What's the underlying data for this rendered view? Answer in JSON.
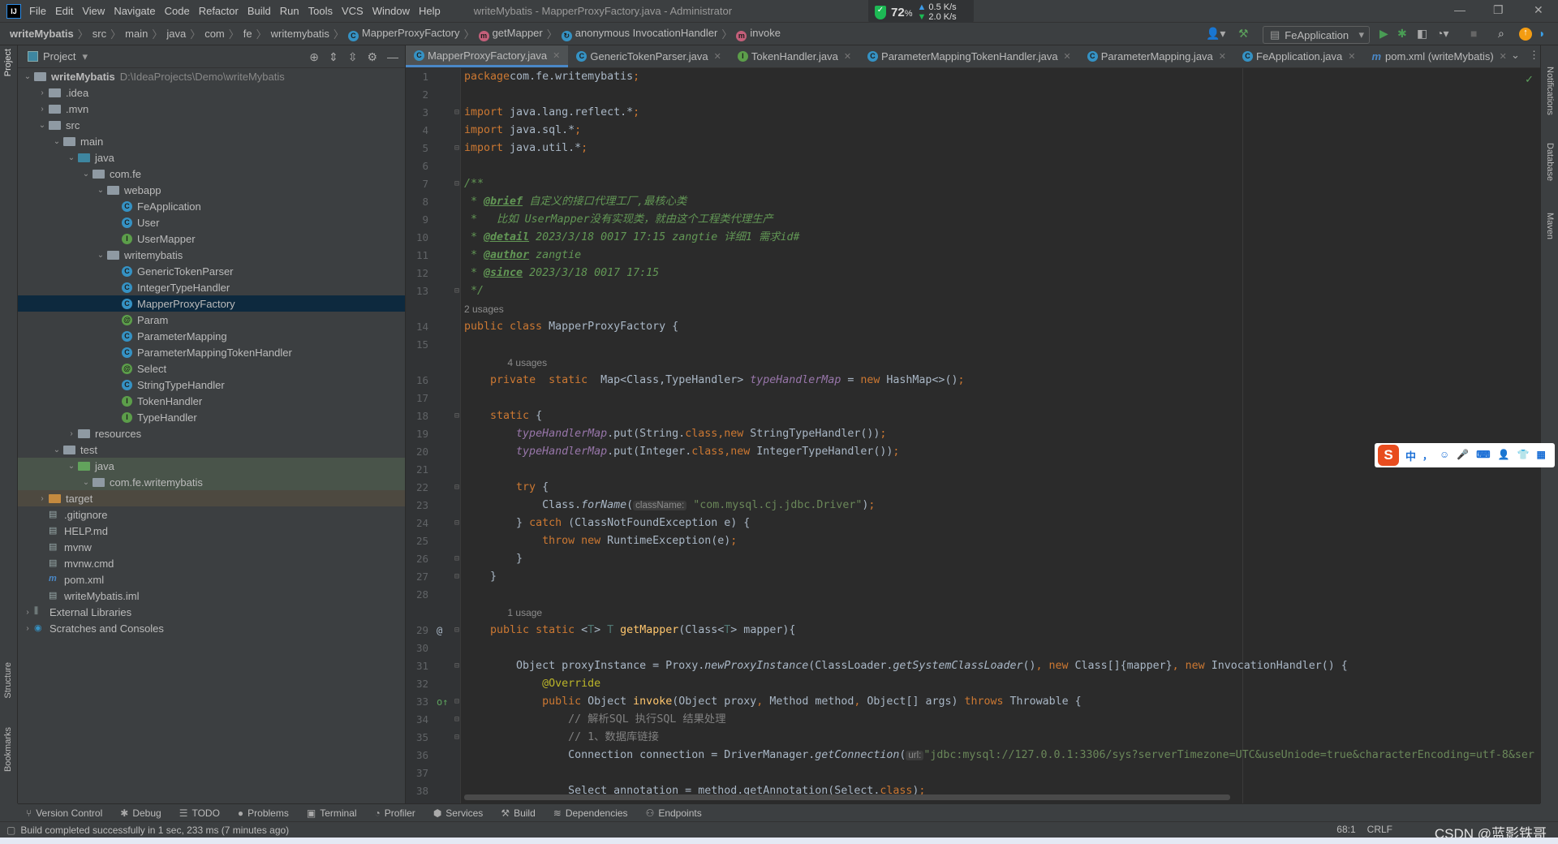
{
  "titlebar": {
    "logo": "IJ",
    "menu": [
      "File",
      "Edit",
      "View",
      "Navigate",
      "Code",
      "Refactor",
      "Build",
      "Run",
      "Tools",
      "VCS",
      "Window",
      "Help"
    ],
    "window_title": "writeMybatis - MapperProxyFactory.java - Administrator"
  },
  "netwidget": {
    "percent": "72",
    "unit": "%",
    "up": "0.5 K/s",
    "down": "2.0 K/s"
  },
  "breadcrumb": [
    {
      "label": "writeMybatis",
      "icon": ""
    },
    {
      "label": "src",
      "icon": ""
    },
    {
      "label": "main",
      "icon": ""
    },
    {
      "label": "java",
      "icon": ""
    },
    {
      "label": "com",
      "icon": ""
    },
    {
      "label": "fe",
      "icon": ""
    },
    {
      "label": "writemybatis",
      "icon": ""
    },
    {
      "label": "MapperProxyFactory",
      "icon": "class"
    },
    {
      "label": "getMapper",
      "icon": "method"
    },
    {
      "label": "anonymous InvocationHandler",
      "icon": "anon"
    },
    {
      "label": "invoke",
      "icon": "method"
    }
  ],
  "run_config": "FeApplication",
  "project": {
    "title": "Project",
    "tree": [
      {
        "d": 0,
        "a": "open",
        "icon": "module",
        "label": "writeMybatis",
        "path": "D:\\IdeaProjects\\Demo\\writeMybatis",
        "bold": true
      },
      {
        "d": 1,
        "a": "closed",
        "icon": "folder",
        "label": ".idea"
      },
      {
        "d": 1,
        "a": "closed",
        "icon": "folder",
        "label": ".mvn"
      },
      {
        "d": 1,
        "a": "open",
        "icon": "folder",
        "label": "src"
      },
      {
        "d": 2,
        "a": "open",
        "icon": "folder",
        "label": "main"
      },
      {
        "d": 3,
        "a": "open",
        "icon": "folder-blue",
        "label": "java"
      },
      {
        "d": 4,
        "a": "open",
        "icon": "package",
        "label": "com.fe"
      },
      {
        "d": 5,
        "a": "open",
        "icon": "package",
        "label": "webapp"
      },
      {
        "d": 6,
        "icon": "class",
        "label": "FeApplication"
      },
      {
        "d": 6,
        "icon": "class",
        "label": "User"
      },
      {
        "d": 6,
        "icon": "interface",
        "label": "UserMapper"
      },
      {
        "d": 5,
        "a": "open",
        "icon": "package",
        "label": "writemybatis"
      },
      {
        "d": 6,
        "icon": "class",
        "label": "GenericTokenParser"
      },
      {
        "d": 6,
        "icon": "class",
        "label": "IntegerTypeHandler"
      },
      {
        "d": 6,
        "icon": "class",
        "label": "MapperProxyFactory",
        "selected": true
      },
      {
        "d": 6,
        "icon": "annotation",
        "label": "Param"
      },
      {
        "d": 6,
        "icon": "class",
        "label": "ParameterMapping"
      },
      {
        "d": 6,
        "icon": "class",
        "label": "ParameterMappingTokenHandler"
      },
      {
        "d": 6,
        "icon": "annotation",
        "label": "Select"
      },
      {
        "d": 6,
        "icon": "class",
        "label": "StringTypeHandler"
      },
      {
        "d": 6,
        "icon": "interface",
        "label": "TokenHandler"
      },
      {
        "d": 6,
        "icon": "interface",
        "label": "TypeHandler"
      },
      {
        "d": 3,
        "a": "closed",
        "icon": "folder",
        "label": "resources"
      },
      {
        "d": 2,
        "a": "open",
        "icon": "folder",
        "label": "test"
      },
      {
        "d": 3,
        "a": "open",
        "icon": "folder-green",
        "label": "java",
        "bg": "test"
      },
      {
        "d": 4,
        "a": "open",
        "icon": "package",
        "label": "com.fe.writemybatis",
        "bg": "test"
      },
      {
        "d": 1,
        "a": "closed",
        "icon": "folder-orange",
        "label": "target",
        "bg": "tgt"
      },
      {
        "d": 1,
        "icon": "file",
        "label": ".gitignore"
      },
      {
        "d": 1,
        "icon": "file",
        "label": "HELP.md"
      },
      {
        "d": 1,
        "icon": "file",
        "label": "mvnw"
      },
      {
        "d": 1,
        "icon": "file",
        "label": "mvnw.cmd"
      },
      {
        "d": 1,
        "icon": "maven",
        "label": "pom.xml"
      },
      {
        "d": 1,
        "icon": "file",
        "label": "writeMybatis.iml"
      },
      {
        "d": 0,
        "a": "closed",
        "icon": "library",
        "label": "External Libraries"
      },
      {
        "d": 0,
        "a": "closed",
        "icon": "scratch",
        "label": "Scratches and Consoles"
      }
    ]
  },
  "tabs": [
    {
      "label": "MapperProxyFactory.java",
      "icon": "class",
      "active": true
    },
    {
      "label": "GenericTokenParser.java",
      "icon": "class"
    },
    {
      "label": "TokenHandler.java",
      "icon": "interface"
    },
    {
      "label": "ParameterMappingTokenHandler.java",
      "icon": "class"
    },
    {
      "label": "ParameterMapping.java",
      "icon": "class"
    },
    {
      "label": "FeApplication.java",
      "icon": "class"
    },
    {
      "label": "pom.xml (writeMybatis)",
      "icon": "maven"
    }
  ],
  "code": [
    {
      "n": 1,
      "t": [
        [
          "k",
          "package"
        ],
        [
          "",
          "com.fe.writemybatis"
        ],
        [
          "k",
          ";"
        ]
      ]
    },
    {
      "n": 2,
      "t": []
    },
    {
      "n": 3,
      "fold": true,
      "t": [
        [
          "k",
          "import"
        ],
        [
          "",
          " java.lang.reflect.*"
        ],
        [
          "k",
          ";"
        ]
      ]
    },
    {
      "n": 4,
      "t": [
        [
          "k",
          "import"
        ],
        [
          "",
          " java.sql.*"
        ],
        [
          "k",
          ";"
        ]
      ]
    },
    {
      "n": 5,
      "fold": true,
      "t": [
        [
          "k",
          "import"
        ],
        [
          "",
          " java.util.*"
        ],
        [
          "k",
          ";"
        ]
      ]
    },
    {
      "n": 6,
      "t": []
    },
    {
      "n": 7,
      "fold": true,
      "t": [
        [
          "d",
          "/**"
        ]
      ]
    },
    {
      "n": 8,
      "t": [
        [
          "d",
          " * "
        ],
        [
          "dt",
          "@brief"
        ],
        [
          "d",
          " 自定义的接口代理工厂,最核心类"
        ]
      ]
    },
    {
      "n": 9,
      "t": [
        [
          "d",
          " *   比如 UserMapper没有实现类，就由这个工程类代理生产"
        ]
      ]
    },
    {
      "n": 10,
      "t": [
        [
          "d",
          " * "
        ],
        [
          "dt",
          "@detail"
        ],
        [
          "d",
          " 2023/3/18 0017 17:15 zangtie 详细1 需求id#"
        ]
      ]
    },
    {
      "n": 11,
      "t": [
        [
          "d",
          " * "
        ],
        [
          "dt",
          "@author"
        ],
        [
          "d",
          " zangtie"
        ]
      ]
    },
    {
      "n": 12,
      "t": [
        [
          "d",
          " * "
        ],
        [
          "dt",
          "@since"
        ],
        [
          "d",
          " 2023/3/18 0017 17:15"
        ]
      ]
    },
    {
      "n": 13,
      "fold": true,
      "t": [
        [
          "d",
          " */"
        ]
      ]
    },
    {
      "usage": "2 usages",
      "indent": ""
    },
    {
      "n": 14,
      "t": [
        [
          "k",
          "public class "
        ],
        [
          "",
          "MapperProxyFactory {"
        ]
      ]
    },
    {
      "n": 15,
      "t": []
    },
    {
      "usage": "4 usages",
      "indent": "    "
    },
    {
      "n": 16,
      "t": [
        [
          "",
          "    "
        ],
        [
          "k",
          "private  static  "
        ],
        [
          "",
          "Map<Class,TypeHandler> "
        ],
        [
          "f",
          "typeHandlerMap"
        ],
        [
          "",
          " = "
        ],
        [
          "k",
          "new "
        ],
        [
          "",
          "HashMap<>()"
        ],
        [
          "k",
          ";"
        ]
      ]
    },
    {
      "n": 17,
      "t": []
    },
    {
      "n": 18,
      "fold": true,
      "t": [
        [
          "",
          "    "
        ],
        [
          "k",
          "static "
        ],
        [
          "",
          "{"
        ]
      ]
    },
    {
      "n": 19,
      "t": [
        [
          "",
          "        "
        ],
        [
          "f",
          "typeHandlerMap"
        ],
        [
          "",
          ".put(String."
        ],
        [
          "k",
          "class,new "
        ],
        [
          "",
          "StringTypeHandler())"
        ],
        [
          "k",
          ";"
        ]
      ]
    },
    {
      "n": 20,
      "t": [
        [
          "",
          "        "
        ],
        [
          "f",
          "typeHandlerMap"
        ],
        [
          "",
          ".put(Integer."
        ],
        [
          "k",
          "class,new "
        ],
        [
          "",
          "IntegerTypeHandler())"
        ],
        [
          "k",
          ";"
        ]
      ]
    },
    {
      "n": 21,
      "t": []
    },
    {
      "n": 22,
      "fold": true,
      "t": [
        [
          "",
          "        "
        ],
        [
          "k",
          "try "
        ],
        [
          "",
          "{"
        ]
      ]
    },
    {
      "n": 23,
      "t": [
        [
          "",
          "            Class."
        ],
        [
          "i",
          "forName"
        ],
        [
          "",
          "("
        ],
        [
          "h",
          "className:"
        ],
        [
          "",
          " "
        ],
        [
          "s",
          "\"com.mysql.cj.jdbc.Driver\""
        ],
        [
          "",
          ")"
        ],
        [
          "k",
          ";"
        ]
      ]
    },
    {
      "n": 24,
      "fold": true,
      "t": [
        [
          "",
          "        } "
        ],
        [
          "k",
          "catch "
        ],
        [
          "",
          "(ClassNotFoundException e) {"
        ]
      ]
    },
    {
      "n": 25,
      "t": [
        [
          "",
          "            "
        ],
        [
          "k",
          "throw new "
        ],
        [
          "",
          "RuntimeException(e)"
        ],
        [
          "k",
          ";"
        ]
      ]
    },
    {
      "n": 26,
      "fold": true,
      "t": [
        [
          "",
          "        }"
        ]
      ]
    },
    {
      "n": 27,
      "fold": true,
      "t": [
        [
          "",
          "    }"
        ]
      ]
    },
    {
      "n": 28,
      "t": []
    },
    {
      "usage": "1 usage",
      "indent": "    "
    },
    {
      "n": 29,
      "mark": "@",
      "fold": true,
      "t": [
        [
          "",
          "    "
        ],
        [
          "k",
          "public static "
        ],
        [
          "",
          "<"
        ],
        [
          "g",
          "T"
        ],
        [
          "",
          "> "
        ],
        [
          "g",
          "T "
        ],
        [
          "m",
          "getMapper"
        ],
        [
          "",
          "(Class<"
        ],
        [
          "g",
          "T"
        ],
        [
          "",
          "> mapper){"
        ]
      ]
    },
    {
      "n": 30,
      "t": []
    },
    {
      "n": 31,
      "fold": true,
      "t": [
        [
          "",
          "        Object proxyInstance = Proxy."
        ],
        [
          "i",
          "newProxyInstance"
        ],
        [
          "",
          "(ClassLoader."
        ],
        [
          "i",
          "getSystemClassLoader"
        ],
        [
          "",
          "()"
        ],
        [
          "k",
          ", new "
        ],
        [
          "",
          "Class[]{mapper}"
        ],
        [
          "k",
          ", new "
        ],
        [
          "",
          "InvocationHandler() {"
        ]
      ]
    },
    {
      "n": 32,
      "t": [
        [
          "",
          "            "
        ],
        [
          "a",
          "@Override"
        ]
      ]
    },
    {
      "n": 33,
      "mark": "o↑",
      "fold": true,
      "t": [
        [
          "",
          "            "
        ],
        [
          "k",
          "public "
        ],
        [
          "",
          "Object "
        ],
        [
          "m",
          "invoke"
        ],
        [
          "",
          "(Object proxy"
        ],
        [
          "k",
          ", "
        ],
        [
          "",
          "Method method"
        ],
        [
          "k",
          ", "
        ],
        [
          "",
          "Object[] args) "
        ],
        [
          "k",
          "throws "
        ],
        [
          "",
          "Throwable {"
        ]
      ]
    },
    {
      "n": 34,
      "fold": true,
      "t": [
        [
          "",
          "                "
        ],
        [
          "c",
          "// 解析SQL 执行SQL 结果处理"
        ]
      ]
    },
    {
      "n": 35,
      "fold": true,
      "t": [
        [
          "",
          "                "
        ],
        [
          "c",
          "// 1、数据库链接"
        ]
      ]
    },
    {
      "n": 36,
      "t": [
        [
          "",
          "                Connection connection = DriverManager."
        ],
        [
          "i",
          "getConnection"
        ],
        [
          "",
          "("
        ],
        [
          "h",
          "url:"
        ],
        [
          "s",
          "\"jdbc:mysql://127.0.0.1:3306/sys?serverTimezone=UTC&useUniode=true&characterEncoding=utf-8&ser"
        ]
      ]
    },
    {
      "n": 37,
      "t": []
    },
    {
      "n": 38,
      "t": [
        [
          "",
          "                Select annotation = method.getAnnotation(Select."
        ],
        [
          "k",
          "class"
        ],
        [
          "",
          ")"
        ],
        [
          "k",
          ";"
        ]
      ]
    }
  ],
  "side": {
    "left_top": "Project",
    "left_structure": "Structure",
    "left_bookmarks": "Bookmarks",
    "right": [
      "Notifications",
      "Database",
      "Maven"
    ]
  },
  "ime": {
    "logo": "S",
    "mode": "中",
    "items": [
      "，",
      "☺",
      "🎤",
      "⌨",
      "👤",
      "👕",
      "▦"
    ]
  },
  "toolwindows": [
    {
      "label": "Version Control",
      "icon": "⑂"
    },
    {
      "label": "Debug",
      "icon": "✱"
    },
    {
      "label": "TODO",
      "icon": "☰"
    },
    {
      "label": "Problems",
      "icon": "●"
    },
    {
      "label": "Terminal",
      "icon": "▣"
    },
    {
      "label": "Profiler",
      "icon": "◔"
    },
    {
      "label": "Services",
      "icon": "⬢"
    },
    {
      "label": "Build",
      "icon": "⚒"
    },
    {
      "label": "Dependencies",
      "icon": "≋"
    },
    {
      "label": "Endpoints",
      "icon": "⚇"
    }
  ],
  "status": {
    "message": "Build completed successfully in 1 sec, 233 ms (7 minutes ago)",
    "position": "68:1",
    "line_sep": "CRLF",
    "watermark": "CSDN @蓝影铁哥"
  },
  "colors": {
    "accent": "#4a88c7",
    "selection": "#0d293e",
    "editor_bg": "#2b2b2b",
    "keyword": "#cc7832",
    "string": "#6a8759",
    "doc": "#629755",
    "field": "#9876aa",
    "method": "#ffc66d"
  }
}
